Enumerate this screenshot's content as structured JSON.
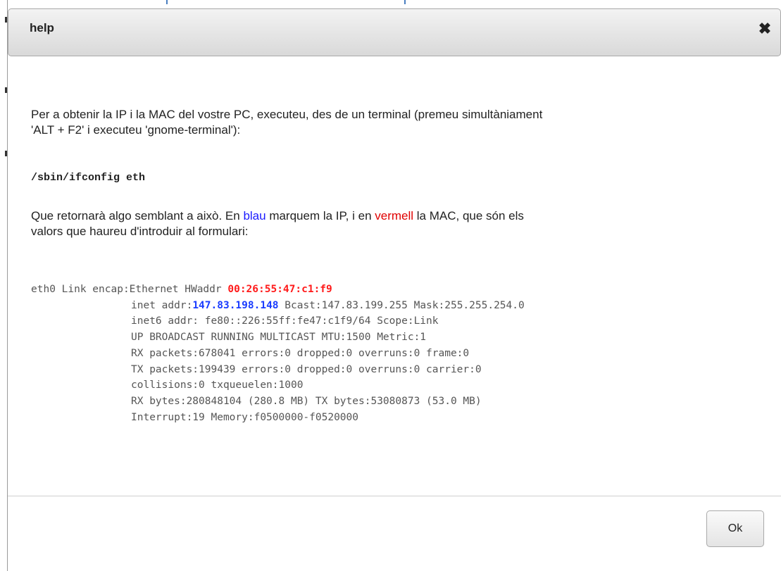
{
  "dialog": {
    "title": "help",
    "close_icon": "close-icon",
    "intro": {
      "line1": "Per a obtenir la IP i la MAC del vostre PC, executeu, des de un terminal (premeu simultàniament",
      "line2": "'ALT + F2' i executeu 'gnome-terminal'):"
    },
    "command": "/sbin/ifconfig eth",
    "explanation": {
      "before_blue": "Que retornarà algo semblant a això. En ",
      "blue_word": "blau",
      "middle": " marquem la IP, i en ",
      "red_word": "vermell",
      "after_red": " la MAC, que són els",
      "line2": "valors que haureu d'introduir al formulari:"
    },
    "terminal": {
      "line1_prefix": "eth0 Link encap:Ethernet HWaddr ",
      "mac": "00:26:55:47:c1:f9",
      "line2_prefix": "inet addr:",
      "ip": "147.83.198.148",
      "line2_suffix": " Bcast:147.83.199.255 Mask:255.255.254.0",
      "line3": "inet6 addr: fe80::226:55ff:fe47:c1f9/64 Scope:Link",
      "line4": "UP BROADCAST RUNNING MULTICAST MTU:1500 Metric:1",
      "line5": "RX packets:678041 errors:0 dropped:0 overruns:0 frame:0",
      "line6": "TX packets:199439 errors:0 dropped:0 overruns:0 carrier:0",
      "line7": "collisions:0 txqueuelen:1000",
      "line8": "RX bytes:280848104 (280.8 MB) TX bytes:53080873 (53.0 MB)",
      "line9": "Interrupt:19 Memory:f0500000-f0520000"
    },
    "ok_label": "Ok"
  },
  "colors": {
    "ip_highlight": "#1a3cff",
    "mac_highlight": "#ff1a1a",
    "blue_text": "#1a1aff",
    "red_text": "#e00000"
  }
}
